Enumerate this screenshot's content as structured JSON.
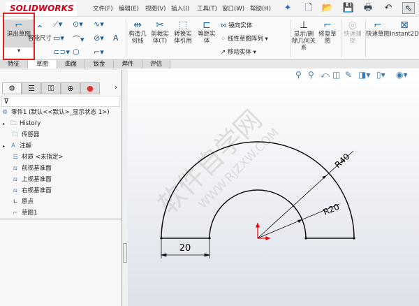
{
  "app": {
    "logo": "SOLIDWORKS"
  },
  "menu": [
    "文件(F)",
    "编辑(E)",
    "视图(V)",
    "插入(I)",
    "工具(T)",
    "窗口(W)",
    "帮助(H)"
  ],
  "quick_icons": [
    "pin-icon",
    "new-document-icon",
    "open-icon",
    "save-icon",
    "print-icon",
    "undo-icon",
    "select-icon"
  ],
  "ribbon": {
    "exit_sketch": "退出草图",
    "smart_dim": "智能尺寸",
    "construction": "构造几何线",
    "trim": "剪裁实体(T)",
    "convert": "转换实体引用",
    "offset": "等距实体",
    "mirror": "镜向实体",
    "linear_pattern": "线性草图阵列",
    "move": "移动实体",
    "show_delete_rel": "显示/删除几何关系",
    "repair": "修复草图",
    "quick_snaps": "快速捕捉",
    "rapid_sketch": "快速草图",
    "instant2d": "Instant2D"
  },
  "tabs": [
    "特征",
    "草图",
    "曲面",
    "钣金",
    "焊件",
    "评估"
  ],
  "active_tab": "草图",
  "tree": {
    "root": "零件1 (默认<<默认>_显示状态 1>)",
    "items": [
      "History",
      "传感器",
      "注解",
      "材质 <未指定>",
      "前视基准面",
      "上视基准面",
      "右视基准面",
      "原点",
      "草图1"
    ]
  },
  "drawing": {
    "dim_width": "20",
    "radius_outer": "R40",
    "radius_inner": "R20",
    "outer_radius_value": 40,
    "inner_radius_value": 20
  },
  "watermark": {
    "text": "软件自学网",
    "url": "WWW.RJZXW.COM"
  },
  "colors": {
    "highlight": "#e02020",
    "accent": "#1a6aa8"
  }
}
